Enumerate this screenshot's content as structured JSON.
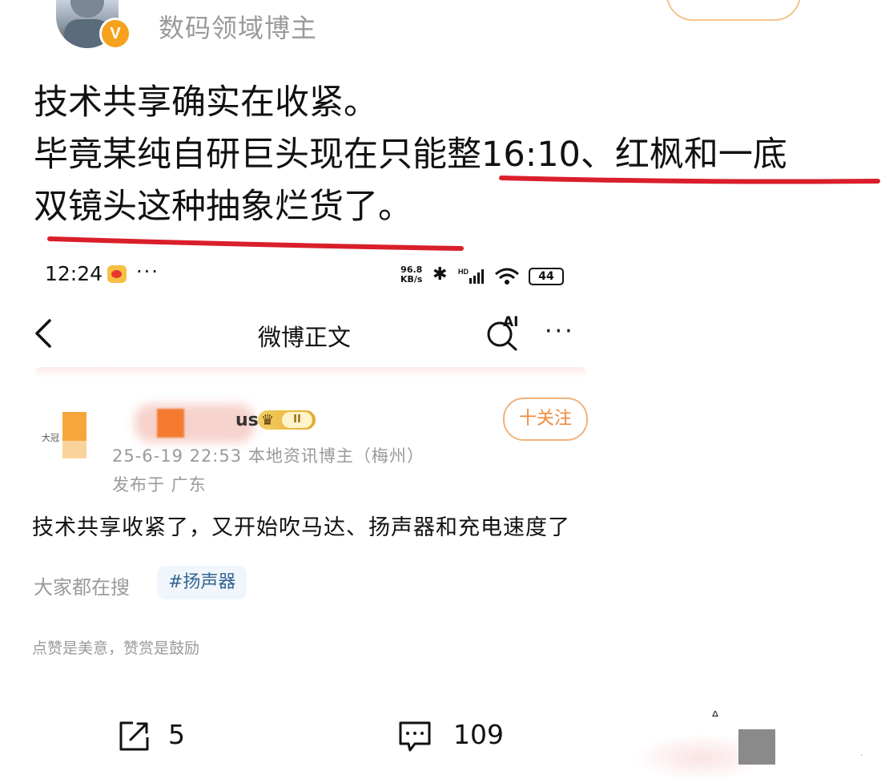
{
  "outer_post": {
    "username": "数码领域博主",
    "verified_badge": "V",
    "text_lines": [
      "技术共享确实在收紧。",
      "毕竟某纯自研巨头现在只能整16:10、红枫和一底",
      "双镜头这种抽象烂货了。"
    ]
  },
  "inner_screenshot": {
    "status_bar": {
      "time": "12:24",
      "dots": "···",
      "speed_value": "96.8",
      "speed_unit": "KB/s",
      "bluetooth_icon": "bluetooth-icon",
      "signal_label": "HD",
      "battery": "44"
    },
    "nav": {
      "title": "微博正文",
      "ai_label": "AI",
      "more": "···"
    },
    "post": {
      "username_fragment": "us",
      "level": "II",
      "meta": "25-6-19 22:53  本地资讯博主（梅州）",
      "location": "发布于 广东",
      "follow_label": "十关注",
      "body": "技术共享收紧了，又开始吹马达、扬声器和充电速度了",
      "search_label": "大家都在搜",
      "search_tag": "#扬声器",
      "reward_text": "点赞是美意，赞赏是鼓励"
    },
    "actions": {
      "share_count": "5",
      "comment_count": "109"
    }
  },
  "colors": {
    "underline": "#d91f2a",
    "verified": "#f7a21c",
    "follow": "#f08a3c",
    "tag_text": "#356592"
  }
}
